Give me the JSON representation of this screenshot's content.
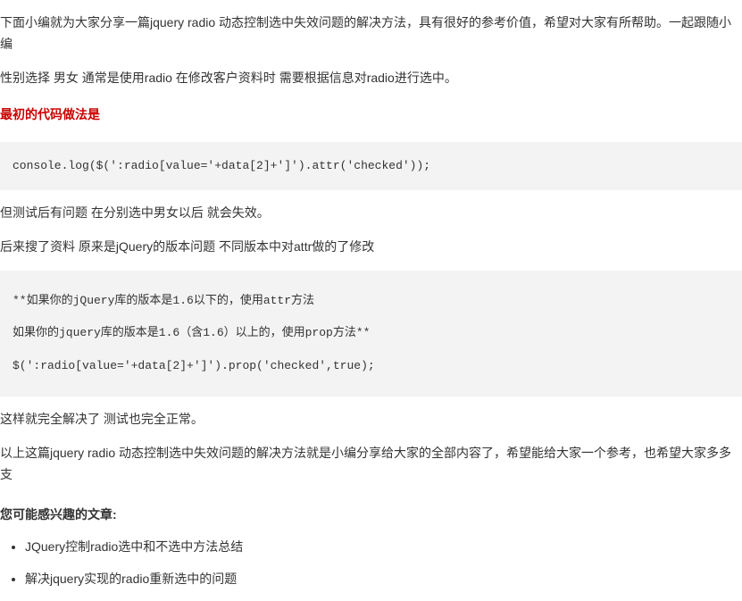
{
  "intro": "下面小编就为大家分享一篇jquery radio 动态控制选中失效问题的解决方法，具有很好的参考价值，希望对大家有所帮助。一起跟随小编",
  "p1": "性别选择 男女 通常是使用radio 在修改客户资料时 需要根据信息对radio进行选中。",
  "heading1": "最初的代码做法是",
  "code1": "console.log($(':radio[value='+data[2]+']').attr('checked'));",
  "p2": "但测试后有问题 在分别选中男女以后 就会失效。",
  "p3": "后来搜了资料  原来是jQuery的版本问题 不同版本中对attr做的了修改",
  "code2_line1": "**如果你的jQuery库的版本是1.6以下的，使用attr方法",
  "code2_line2": "如果你的jquery库的版本是1.6（含1.6）以上的，使用prop方法**",
  "code2_line3": "$(':radio[value='+data[2]+']').prop('checked',true);",
  "p4": "这样就完全解决了 测试也完全正常。",
  "p5": "以上这篇jquery radio 动态控制选中失效问题的解决方法就是小编分享给大家的全部内容了，希望能给大家一个参考，也希望大家多多支",
  "related_title": "您可能感兴趣的文章:",
  "related_links": [
    "JQuery控制radio选中和不选中方法总结",
    "解决jquery实现的radio重新选中的问题"
  ]
}
